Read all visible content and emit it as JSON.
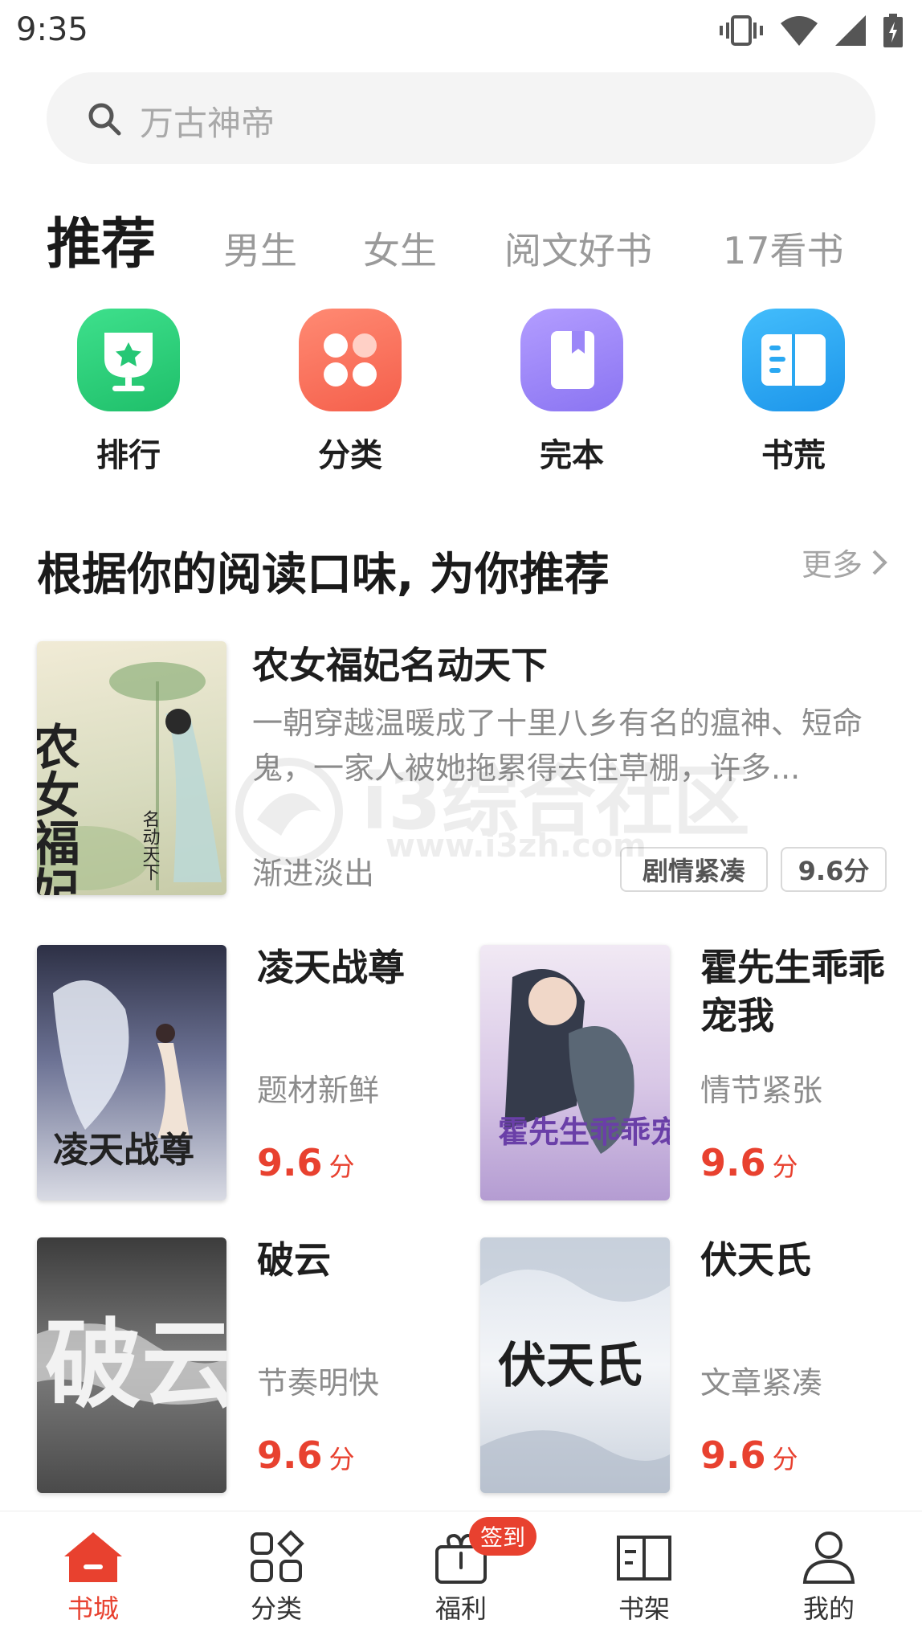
{
  "status_bar": {
    "time": "9:35"
  },
  "search": {
    "placeholder": "万古神帝"
  },
  "tabs": [
    {
      "label": "推荐",
      "active": true
    },
    {
      "label": "男生"
    },
    {
      "label": "女生"
    },
    {
      "label": "阅文好书"
    },
    {
      "label": "17看书"
    }
  ],
  "entries": [
    {
      "label": "排行",
      "icon": "trophy-icon",
      "color": "#2ed07a"
    },
    {
      "label": "分类",
      "icon": "category-icon",
      "color": "#fb6d5a"
    },
    {
      "label": "完本",
      "icon": "book-icon",
      "color": "#9b86f8"
    },
    {
      "label": "书荒",
      "icon": "open-book-icon",
      "color": "#2aa8f2"
    }
  ],
  "section": {
    "title": "根据你的阅读口味, 为你推荐",
    "more": "更多"
  },
  "featured": {
    "title": "农女福妃名动天下",
    "description": "一朝穿越温暖成了十里八乡有名的瘟神、短命鬼，一家人被她拖累得去住草棚，许多...",
    "author": "渐进淡出",
    "tags": [
      "剧情紧凑",
      "9.6分"
    ],
    "cover_text": "农女福妃",
    "cover_sub": "名动天下"
  },
  "books": [
    {
      "title": "凌天战尊",
      "tag": "题材新鲜",
      "score": "9.6",
      "unit": "分",
      "cover_text": "凌天战尊"
    },
    {
      "title": "霍先生乖乖宠我",
      "tag": "情节紧张",
      "score": "9.6",
      "unit": "分",
      "cover_text": "霍先生乖乖宠我"
    },
    {
      "title": "破云",
      "tag": "节奏明快",
      "score": "9.6",
      "unit": "分",
      "cover_text": "破云"
    },
    {
      "title": "伏天氏",
      "tag": "文章紧凑",
      "score": "9.6",
      "unit": "分",
      "cover_text": "伏天氏"
    }
  ],
  "watermark": {
    "text": "i3综合社区",
    "url": "www.i3zh.com"
  },
  "nav": [
    {
      "label": "书城",
      "icon": "home-icon",
      "active": true
    },
    {
      "label": "分类",
      "icon": "category-icon"
    },
    {
      "label": "福利",
      "icon": "gift-icon",
      "badge": "签到"
    },
    {
      "label": "书架",
      "icon": "bookshelf-icon"
    },
    {
      "label": "我的",
      "icon": "user-icon"
    }
  ],
  "colors": {
    "accent": "#e8412f"
  }
}
